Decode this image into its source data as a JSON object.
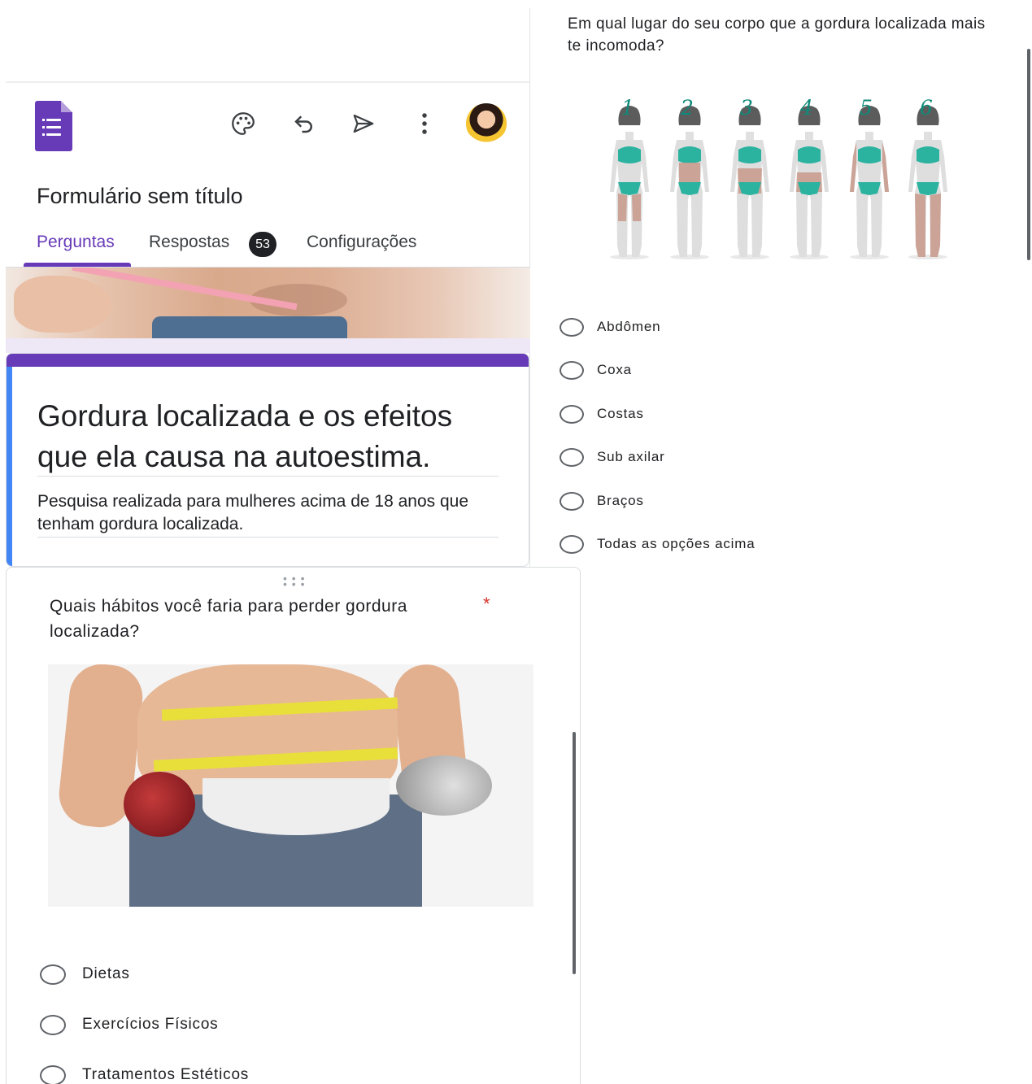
{
  "app": {
    "title": "Formulário sem título",
    "accent_color": "#673ab7",
    "toolbar_icons": [
      "palette-icon",
      "undo-icon",
      "send-icon",
      "more-vert-icon"
    ]
  },
  "tabs": [
    {
      "label": "Perguntas",
      "active": true
    },
    {
      "label": "Respostas",
      "badge": "53"
    },
    {
      "label": "Configurações"
    }
  ],
  "form": {
    "title": "Gordura localizada e os efeitos que ela causa na autoestima.",
    "description": "Pesquisa realizada para mulheres acima de 18 anos que tenham gordura localizada."
  },
  "question1": {
    "title": "Quais hábitos você faria para perder gordura localizada?",
    "required_mark": "*",
    "options": [
      "Dietas",
      "Exercícios Físicos",
      "Tratamentos Estéticos"
    ]
  },
  "question2": {
    "title": "Em qual lugar do seu corpo que a gordura localizada mais te incomoda?",
    "figure_numbers": [
      "1",
      "2",
      "3",
      "4",
      "5",
      "6"
    ],
    "options": [
      "Abdômen",
      "Coxa",
      "Costas",
      "Sub axilar",
      "Braços",
      "Todas as opções acima"
    ]
  }
}
